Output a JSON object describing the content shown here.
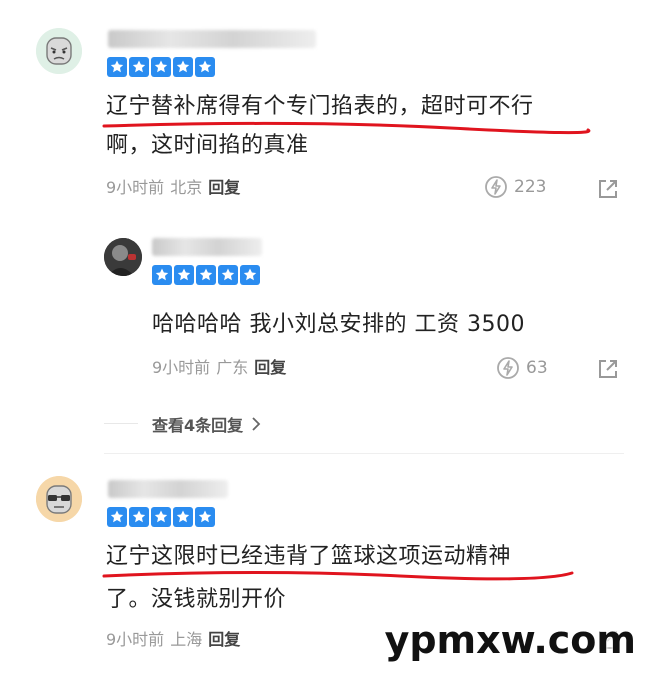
{
  "comments": [
    {
      "username": "",
      "stars": 5,
      "text_line1": "辽宁替补席得有个专门掐表的，超时可不行",
      "text_line2": "啊，这时间掐的真准",
      "time": "9小时前",
      "location": "北京",
      "reply_label": "回复",
      "likes": "223"
    },
    {
      "username": "",
      "stars": 5,
      "text_line1": "哈哈哈哈 我小刘总安排的 工资 3500",
      "time": "9小时前",
      "location": "广东",
      "reply_label": "回复",
      "likes": "63"
    },
    {
      "username": "",
      "stars": 5,
      "text_line1": "辽宁这限时已经违背了篮球这项运动精神",
      "text_line2": "了。没钱就别开价",
      "time": "9小时前",
      "location": "上海",
      "reply_label": "回复",
      "likes": ""
    }
  ],
  "view_replies_label": "查看4条回复",
  "watermark": "ypmxw.com",
  "colors": {
    "star": "#2a8cf0",
    "underline": "#e0141e",
    "meta": "#999999"
  },
  "icons": {
    "like": "lightning-like-icon",
    "share": "share-arrow-icon",
    "chevron": "chevron-right-icon"
  }
}
